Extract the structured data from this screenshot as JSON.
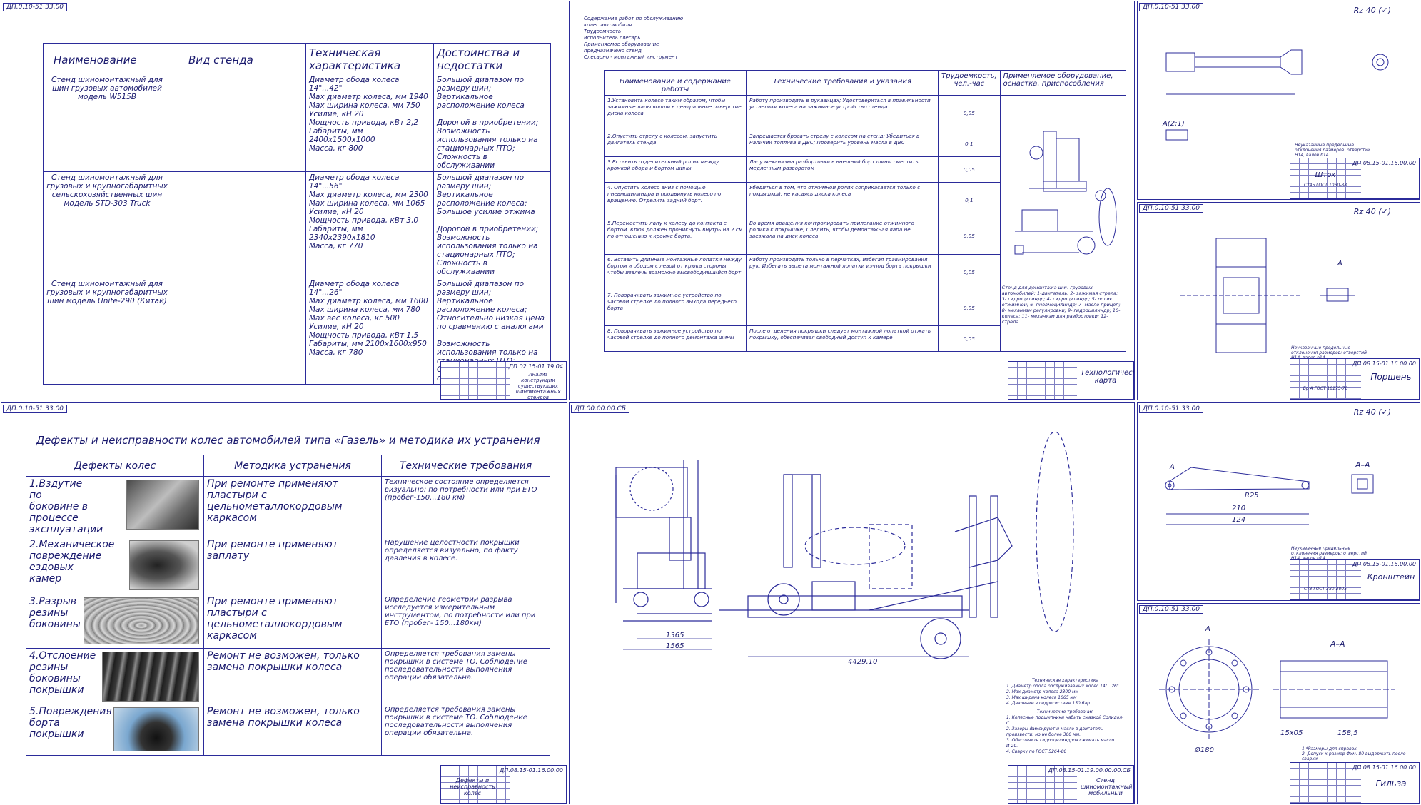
{
  "sheet1": {
    "stamp": "ДП.0.10-51.33.00",
    "headers": [
      "Наименование",
      "Вид стенда",
      "Техническая характеристика",
      "Достоинства и недостатки"
    ],
    "rows": [
      {
        "name": "Стенд шиномонтажный для шин грузовых автомобилей модель W515B",
        "specs": "Диаметр обода колеса 14\"...42\"\nMax диаметр колеса, мм 1940\nMax ширина колеса, мм 750\nУсилие, кН 20\nМощность привода, кВт 2,2\nГабариты, мм 2400x1500x1000\nМасса, кг 800",
        "pros": "Большой диапазон по размеру шин;\nВертикальное расположение колеса\n\nДорогой в приобретении;\nВозможность использования только на стационарных ПТО;\nСложность в обслуживании"
      },
      {
        "name": "Стенд шиномонтажный для грузовых и крупногабаритных сельскохозяйственных шин модель STD-303 Truck",
        "specs": "Диаметр обода колеса 14\"...56\"\nMax диаметр колеса, мм 2300\nMax ширина колеса, мм 1065\nУсилие, кН 20\nМощность привода, кВт 3,0\nГабариты, мм 2340x2390x1810\nМасса, кг 770",
        "pros": "Большой диапазон по размеру шин;\nВертикальное расположение колеса;\nБольшое усилие отжима\n\nДорогой в приобретении;\nВозможность использования только на стационарных ПТО;\nСложность в обслуживании"
      },
      {
        "name": "Стенд шиномонтажный для грузовых и крупногабаритных шин модель Unite-290 (Китай)",
        "specs": "Диаметр обода колеса 14\"...26\"\nMax диаметр колеса, мм 1600\nMax ширина колеса, мм 780\nMax вес колеса, кг 500\nУсилие, кН 20\nМощность привода, кВт 1,5\nГабариты, мм 2100x1600x950\nМасса, кг 780",
        "pros": "Большой диапазон по размеру шин;\nВертикальное расположение колеса;\nОтносительно низкая цена по сравнению с аналогами\n\nВозможность использования только на стационарных ПТО;\nСложность в обслуживании"
      }
    ],
    "titleblock": {
      "code": "ДП.02.15-01.19.04",
      "name": "Анализ конструкции существующих шиномонтажных стендов"
    }
  },
  "sheet2": {
    "notes": [
      "Содержание работ по обслуживанию",
      "колес автомобиля",
      "Трудоемкость",
      "исполнитель слесарь",
      "Применяемое оборудование",
      "предназначено стенд",
      "Слесарно - монтажный инструмент"
    ],
    "headers": [
      "Наименование и содержание работы",
      "Технические требования и указания",
      "Трудоемкость, чел.-час",
      "Применяемое оборудование, оснастка, приспособления"
    ],
    "rows": [
      {
        "work": "1.Установить колесо таким образом, чтобы зажимные лапы вошли в центральное отверстие диска колеса",
        "req": "Работу производить в рукавицах; Удостовериться в правильности установки колеса на зажимное устройство стенда",
        "time": "0,05"
      },
      {
        "work": "2.Опустить стрелу с колесом, запустить двигатель стенда",
        "req": "Запрещается бросать стрелу с колесом на стенд; Убедиться в наличии топлива в ДВС; Проверить уровень масла в ДВС",
        "time": "0,1"
      },
      {
        "work": "3.Вставить отделительный ролик между кромкой обода и бортом шины",
        "req": "Лапу механизма разбортовки в внешний борт шины сместить медленным разворотом",
        "time": "0,05"
      },
      {
        "work": "4. Опустить колесо вниз с помощью пневмоцилиндра и продвинуть колесо по вращению. Отделить задний борт.",
        "req": "Убедиться в том, что отжимной ролик соприкасается только с покрышкой, не касаясь диска колеса",
        "time": "0,1"
      },
      {
        "work": "5.Переместить лапу к колесу до контакта с бортом. Крюк должен проникнуть внутрь на 2 см по отношению к кромке борта.",
        "req": "Во время вращения контролировать прилегание отжимного ролика к покрышке; Следить, чтобы демонтажная лапа не заезжала на диск колеса",
        "time": "0,05"
      },
      {
        "work": "6. Вставить длинные монтажные лопатки между бортом и ободом с левой от крюка стороны, чтобы извлечь возможно высвободившийся борт",
        "req": "Работу производить только в перчатках, избегая травмирования рук. Избегать вылета монтажной лопатки из-под борта покрышки",
        "time": "0,05"
      },
      {
        "work": "7. Поворачивать зажимное устройство по часовой стрелке до полного выхода переднего борта",
        "req": "",
        "time": "0,05"
      },
      {
        "work": "8. Поворачивать зажимное устройство по часовой стрелке до полного демонтажа шины",
        "req": "После отделения покрышки следует монтажной лопаткой отжать покрышку, обеспечивая свободный доступ к камере",
        "time": "0,05"
      }
    ],
    "legend": "Стенд для демонтажа шин грузовых автомобилей: 1-двигатель; 2- зажимая стрела; 3- гидроцилиндр; 4- гидроцилиндр; 5- ролик отжимной; 6- пневмоцилиндр; 7- масло прицеп; 8- механизм регулировки; 9- гидроцилиндр; 10- колеса; 11- механизм для разбортовки; 12- стрела",
    "titleblock": {
      "code": "",
      "name": "Технологическая карта"
    }
  },
  "sheet3": {
    "stamp": "ДП.0.10-51.33.00",
    "rz": "Rz 40 (✓)",
    "label": "А(2:1)",
    "note": "Неуказанные предельные отклонения размеров: отверстий Н14, валов h14",
    "titleblock": {
      "code": "ДП.08.15-01.16.00.00",
      "name": "Шток",
      "material": "Ст45 ГОСТ 1050-88"
    }
  },
  "sheet4": {
    "stamp": "ДП.0.10-51.33.00",
    "rz": "Rz 40 (✓)",
    "label": "А",
    "note": "Неуказанные предельные отклонения размеров: отверстий Н14, валов h14",
    "titleblock": {
      "code": "ДП.08.15-01.16.00.00",
      "name": "Поршень",
      "material": "Бр А ГОСТ 18175-78"
    }
  },
  "sheet5": {
    "title": "Дефекты и неисправности колес автомобилей типа «Газель» и методика их устранения",
    "headers": [
      "Дефекты колес",
      "Методика устранения",
      "Технические требования"
    ],
    "rows": [
      {
        "defect": "1.Вздутие по боковине в процессе эксплуатации",
        "method": "При ремонте применяют пластыри с цельнометаллокордовым каркасом",
        "req": "Техническое состояние определяется визуально; по потребности или при ЕТО (пробег-150...180 км)"
      },
      {
        "defect": "2.Механическое повреждение ездовых камер",
        "method": "При ремонте применяют заплату",
        "req": "Нарушение целостности покрышки определяется визуально, по факту давления в колесе."
      },
      {
        "defect": "3.Разрыв резины боковины",
        "method": "При ремонте применяют пластыри с цельнометаллокордовым каркасом",
        "req": "Определение геометрии разрыва исследуется измерительным инструментом, по потребности или при ЕТО (пробег- 150...180км)"
      },
      {
        "defect": "4.Отслоение резины боковины покрышки",
        "method": "Ремонт не возможен, только замена покрышки колеса",
        "req": "Определяется требования замены покрышки в системе ТО. Соблюдение последовательности выполнения операции обязательна."
      },
      {
        "defect": "5.Повреждения борта покрышки",
        "method": "Ремонт не возможен, только замена покрышки колеса",
        "req": "Определяется требования замены покрышки в системе ТО. Соблюдение последовательности выполнения операции обязательна."
      }
    ],
    "titleblock": {
      "code": "ДП.08.15-01.16.00.00",
      "name": "Дефекты и неисправность колес"
    }
  },
  "sheet6": {
    "stamp": "ДП.00.00.00.СБ",
    "dims": [
      "1565",
      "1365",
      "4429.10"
    ],
    "specs_title": "Техническая характеристика",
    "specs": "1. Диаметр обода обслуживаемых колес 14\"...26\"\n2. Max диаметр колеса 2300 мм\n3. Max ширина колеса 1065 мм\n4. Давление в гидросистеме 150 бар",
    "reqs_title": "Технические требования",
    "reqs": "1. Колесные подшипники набить смазкой Солидол-С.\n2. Зазоры фиксируют и масло в двигатель произвести, но не более 300 мм.\n3. Обеспечить гидроцилиндров сжимать масло И-20.\n4. Сварку по ГОСТ 5264-80",
    "titleblock": {
      "code": "ДП.08.15-01.19.00.00.00.СБ",
      "name": "Стенд шиномонтажный мобильный"
    }
  },
  "sheet7": {
    "stamp": "ДП.0.10-51.33.00",
    "rz": "Rz 40 (✓)",
    "labels": [
      "А",
      "А–А"
    ],
    "dims": [
      "210",
      "124",
      "R25"
    ],
    "note": "Неуказанные предельные отклонения размеров: отверстий Н14, валов h14",
    "titleblock": {
      "code": "ДП.08.15-01.16.00.00",
      "name": "Кронштейн",
      "material": "Ст3 ГОСТ 380-2005"
    }
  },
  "sheet8": {
    "stamp": "ДП.0.10-51.33.00",
    "labels": [
      "А",
      "А–А"
    ],
    "dims": [
      "Ø180",
      "158,5",
      "15х05"
    ],
    "note": "1.*Размеры для справок\n2. Допуск к размер Фхм. 80 выдержать после сварки",
    "titleblock": {
      "code": "ДП.08.15-01.16.00.00",
      "name": "Гильза"
    }
  },
  "colors": {
    "line": "#2b2b9a",
    "paper": "#ffffff"
  }
}
